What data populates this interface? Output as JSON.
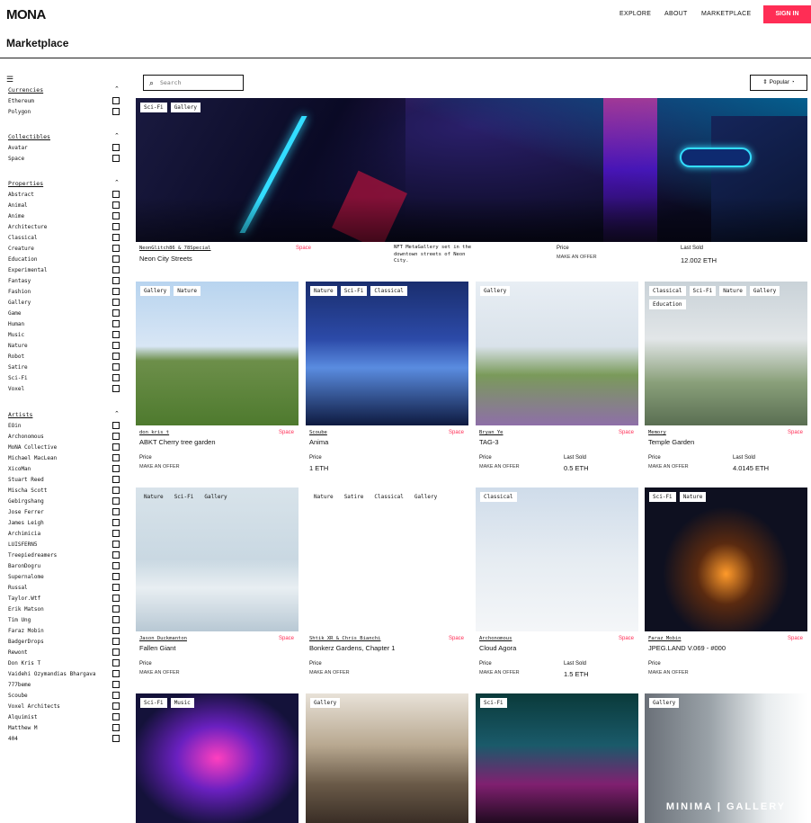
{
  "header": {
    "logo": "MONA",
    "nav": [
      "EXPLORE",
      "ABOUT",
      "MARKETPLACE"
    ],
    "signin": "SIGN IN",
    "page_title": "Marketplace"
  },
  "sidebar": {
    "menu_icon": "hamburger-icon",
    "sections": [
      {
        "title": "Currencies",
        "items": [
          "Ethereum",
          "Polygon"
        ]
      },
      {
        "title": "Collectibles",
        "items": [
          "Avatar",
          "Space"
        ]
      },
      {
        "title": "Properties",
        "items": [
          "Abstract",
          "Animal",
          "Anime",
          "Architecture",
          "Classical",
          "Creature",
          "Education",
          "Experimental",
          "Fantasy",
          "Fashion",
          "Gallery",
          "Game",
          "Human",
          "Music",
          "Nature",
          "Robot",
          "Satire",
          "Sci-Fi",
          "Voxel"
        ]
      },
      {
        "title": "Artists",
        "items": [
          "EOin",
          "Archonomous",
          "MoNA Collective",
          "Michael MacLean",
          "XicoMan",
          "Stuart Reed",
          "Mischa Scott",
          "Gebirgshang",
          "Jose Ferrer",
          "James Leigh",
          "Archimicia",
          "LUISFERN5",
          "Treepiedreamers",
          "BaronDogru",
          "Supernalome",
          "Russal",
          "Taylor.Wtf",
          "Erik Matson",
          "Tim Ung",
          "Faraz Mobin",
          "BadgerDrops",
          "Rewont",
          "Don Kris T",
          "Vaidehi Ozymandias Bhargava",
          "777beme",
          "Scoube",
          "Voxel Architects",
          "Alquimist",
          "Matthew M",
          "404"
        ]
      }
    ]
  },
  "toolbar": {
    "search_placeholder": "Search",
    "sort_label": "Popular"
  },
  "featured": {
    "tags": [
      "Sci-Fi",
      "Gallery"
    ],
    "author": "NeonGlitch86 & 78Special",
    "space": "Space",
    "name": "Neon City Streets",
    "description": "NFT MetaGallery set in the downtown streets of Neon City.",
    "price_label": "Price",
    "price_value": "MAKE AN OFFER",
    "last_label": "Last Sold",
    "last_value": "12.002 ETH"
  },
  "cards": [
    {
      "tags": [
        "Gallery",
        "Nature"
      ],
      "author": "don kris t",
      "space": "Space",
      "name": "ABKT Cherry tree garden",
      "price_label": "Price",
      "price_value": "MAKE AN OFFER",
      "last_label": "",
      "last_value": ""
    },
    {
      "tags": [
        "Nature",
        "Sci-Fi",
        "Classical"
      ],
      "author": "Scoube",
      "space": "Space",
      "name": "Anima",
      "price_label": "Price",
      "price_value": "1 ETH",
      "last_label": "",
      "last_value": ""
    },
    {
      "tags": [
        "Gallery"
      ],
      "author": "Bryan Ye",
      "space": "Space",
      "name": "TAG-3",
      "price_label": "Price",
      "price_value": "MAKE AN OFFER",
      "last_label": "Last Sold",
      "last_value": "0.5 ETH"
    },
    {
      "tags": [
        "Classical",
        "Sci-Fi",
        "Nature",
        "Gallery",
        "Education"
      ],
      "author": "Memory",
      "space": "Space",
      "name": "Temple Garden",
      "price_label": "Price",
      "price_value": "MAKE AN OFFER",
      "last_label": "Last Sold",
      "last_value": "4.0145 ETH"
    },
    {
      "tags": [
        "Nature",
        "Sci-Fi",
        "Gallery"
      ],
      "author": "Jason Duckmanton",
      "space": "Space",
      "name": "Fallen Giant",
      "price_label": "Price",
      "price_value": "MAKE AN OFFER",
      "last_label": "",
      "last_value": ""
    },
    {
      "tags": [
        "Nature",
        "Satire",
        "Classical",
        "Gallery"
      ],
      "author": "Shtik XR & Chris Bianchi",
      "space": "Space",
      "name": "Bonkerz Gardens, Chapter 1",
      "price_label": "Price",
      "price_value": "MAKE AN OFFER",
      "last_label": "",
      "last_value": ""
    },
    {
      "tags": [
        "Classical"
      ],
      "author": "Archonomous",
      "space": "Space",
      "name": "Cloud Agora",
      "price_label": "Price",
      "price_value": "MAKE AN OFFER",
      "last_label": "Last Sold",
      "last_value": "1.5 ETH"
    },
    {
      "tags": [
        "Sci-Fi",
        "Nature"
      ],
      "author": "Faraz Mobin",
      "space": "Space",
      "name": "JPEG.LAND V.069 - #000",
      "price_label": "Price",
      "price_value": "MAKE AN OFFER",
      "last_label": "",
      "last_value": ""
    },
    {
      "tags": [
        "Sci-Fi",
        "Music"
      ]
    },
    {
      "tags": [
        "Gallery"
      ]
    },
    {
      "tags": [
        "Sci-Fi"
      ]
    },
    {
      "tags": [
        "Gallery"
      ],
      "image_text": "MINIMA | GALLERY"
    }
  ],
  "colors": {
    "accent": "#ff2d55",
    "border": "#111111"
  }
}
